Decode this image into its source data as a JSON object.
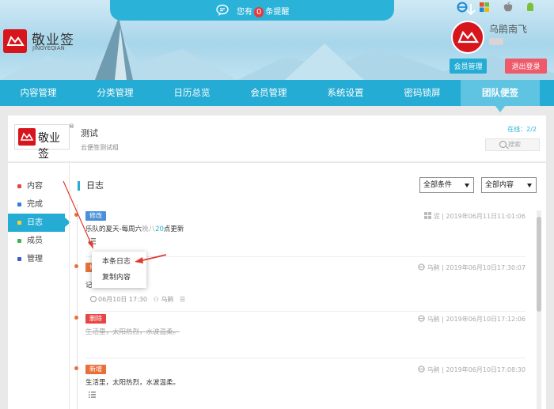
{
  "notice": {
    "prefix": "您有",
    "count": "0",
    "suffix": "条提醒"
  },
  "brand": {
    "name": "敬业签",
    "sub": "JINGYEQIAN"
  },
  "user": {
    "name": "乌鹃南飞",
    "member_btn": "会员管理",
    "logout_btn": "退出登录"
  },
  "nav": [
    "内容管理",
    "分类管理",
    "日历总览",
    "会员管理",
    "系统设置",
    "密码锁屏",
    "团队便签"
  ],
  "team": {
    "logo_text": "敬业签",
    "title": "测试",
    "subtitle": "云便签测试组",
    "online_label": "在线：",
    "online_count": "2/2",
    "search_placeholder": "搜索"
  },
  "sidebar": [
    {
      "label": "内容",
      "color": "#e64545"
    },
    {
      "label": "完成",
      "color": "#2e7fd6"
    },
    {
      "label": "日志",
      "color": "#ffd02b"
    },
    {
      "label": "成员",
      "color": "#3ab54a"
    },
    {
      "label": "管理",
      "color": "#3a5bd0"
    }
  ],
  "page_title": "日志",
  "filters": {
    "condition": "全部条件",
    "content": "全部内容"
  },
  "entries": [
    {
      "badge": "修改",
      "badge_color": "#4a90d9",
      "author": "泥",
      "time": "2019年06月11日11:01:06",
      "parts": [
        "乐队的夏天-每周六",
        "晚八",
        "20",
        "点更新"
      ]
    },
    {
      "badge": "修改",
      "badge_color": "#e8703a",
      "author": "乌鹃",
      "time": "2019年06月10日17:30:07",
      "content_prefix": "记",
      "remind": "06月10日 17:30",
      "assignee": "乌鹃"
    },
    {
      "badge": "删除",
      "badge_color": "#e84545",
      "author": "乌鹃",
      "time": "2019年06月10日17:12:06",
      "content": "生活里，太阳热烈，水波温柔。"
    },
    {
      "badge": "新增",
      "badge_color": "#e8703a",
      "author": "乌鹃",
      "time": "2019年06月10日17:08:30",
      "content": "生活里，太阳热烈，水波温柔。"
    }
  ],
  "context_menu": [
    "本条日志",
    "复制内容"
  ],
  "colors": {
    "primary": "#25acd4",
    "brand": "#d7151d",
    "logout": "#ee5a6a"
  }
}
